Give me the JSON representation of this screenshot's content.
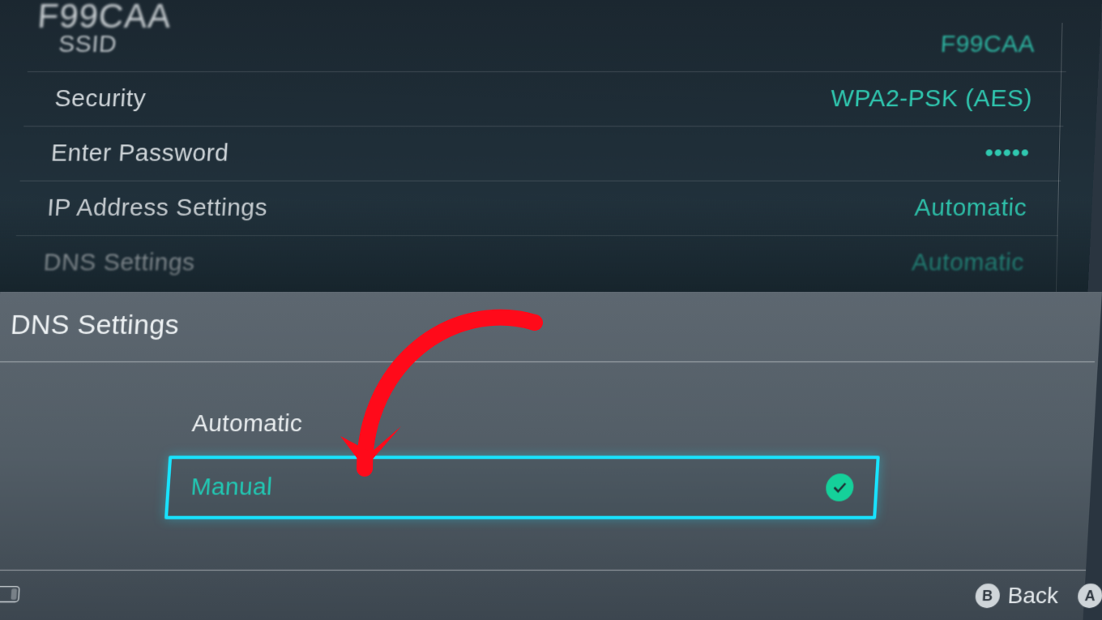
{
  "bg": {
    "title": "F99CAA",
    "rows": [
      {
        "label": "SSID",
        "value": "F99CAA"
      },
      {
        "label": "Security",
        "value": "WPA2-PSK (AES)"
      },
      {
        "label": "Enter Password",
        "value": "•••••"
      },
      {
        "label": "IP Address Settings",
        "value": "Automatic"
      },
      {
        "label": "DNS Settings",
        "value": "Automatic"
      }
    ]
  },
  "modal": {
    "title": "DNS Settings",
    "options": {
      "automatic": "Automatic",
      "manual": "Manual"
    }
  },
  "footer": {
    "back_button_letter": "B",
    "back_label": "Back",
    "ok_button_letter": "A"
  }
}
